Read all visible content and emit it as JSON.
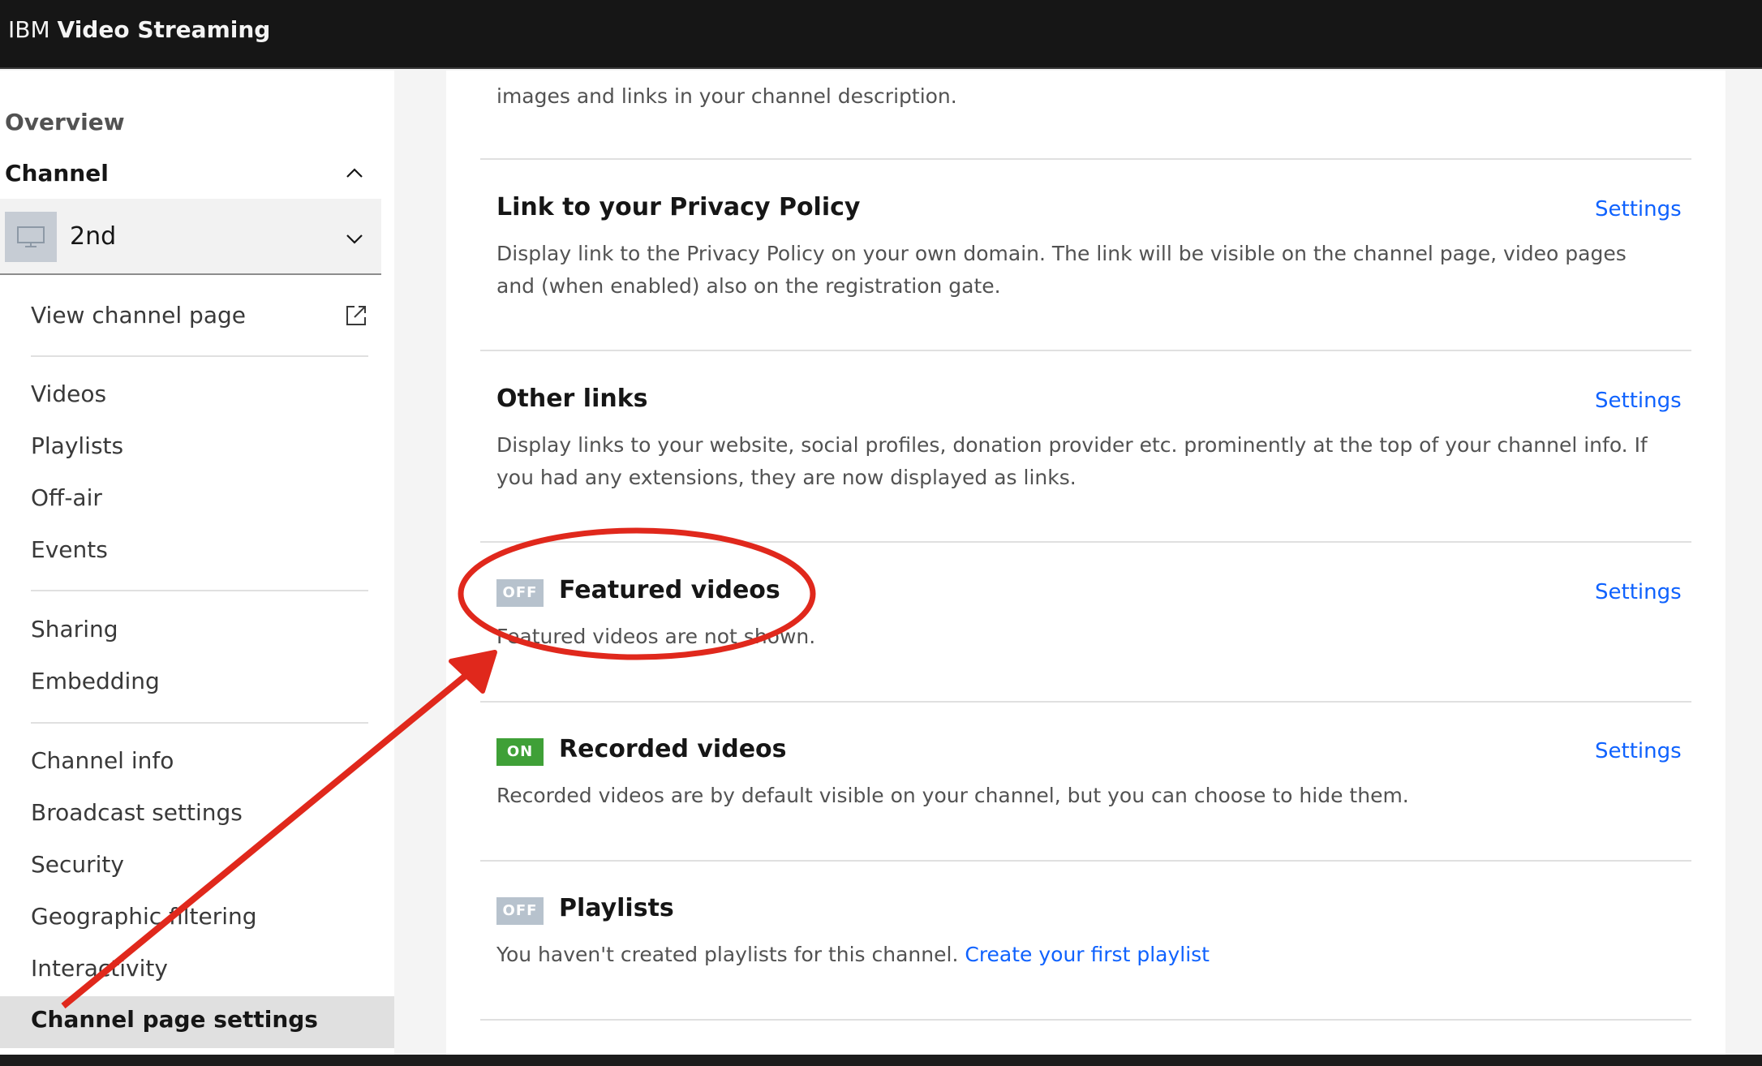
{
  "app": {
    "brand_prefix": "IBM",
    "brand_name": "Video Streaming"
  },
  "sidebar": {
    "overview_label": "Overview",
    "channel_label": "Channel",
    "channel_selector": {
      "value": "2nd"
    },
    "view_channel_page": "View channel page",
    "groups": [
      {
        "items": [
          "Videos",
          "Playlists",
          "Off-air",
          "Events"
        ]
      },
      {
        "items": [
          "Sharing",
          "Embedding"
        ]
      },
      {
        "items": [
          "Channel info",
          "Broadcast settings",
          "Security",
          "Geographic filtering",
          "Interactivity"
        ]
      }
    ],
    "active_item": "Channel page settings"
  },
  "main": {
    "cut_off_text": "images and links in your channel description.",
    "sections": [
      {
        "title": "Link to your Privacy Policy",
        "description": "Display link to the Privacy Policy on your own domain. The link will be visible on the channel page, video pages and (when enabled) also on the registration gate.",
        "settings_label": "Settings"
      },
      {
        "title": "Other links",
        "description": "Display links to your website, social profiles, donation provider etc. prominently at the top of your channel info. If you had any extensions, they are now displayed as links.",
        "settings_label": "Settings"
      },
      {
        "badge": "OFF",
        "title": "Featured videos",
        "description": "Featured videos are not shown.",
        "settings_label": "Settings"
      },
      {
        "badge": "ON",
        "title": "Recorded videos",
        "description": "Recorded videos are by default visible on your channel, but you can choose to hide them.",
        "settings_label": "Settings"
      },
      {
        "badge": "OFF",
        "title": "Playlists",
        "description": "You haven't created playlists for this channel.",
        "link_label": "Create your first playlist"
      }
    ]
  },
  "colors": {
    "topbar": "#161616",
    "link": "#0f62fe",
    "badge_off": "#b7c2cd",
    "badge_on": "#3fa037",
    "annotation": "#e0281c"
  },
  "icons": {
    "channel_thumb": "monitor-icon",
    "collapse": "chevron-up-icon",
    "expand": "chevron-down-icon",
    "external": "external-link-icon"
  }
}
